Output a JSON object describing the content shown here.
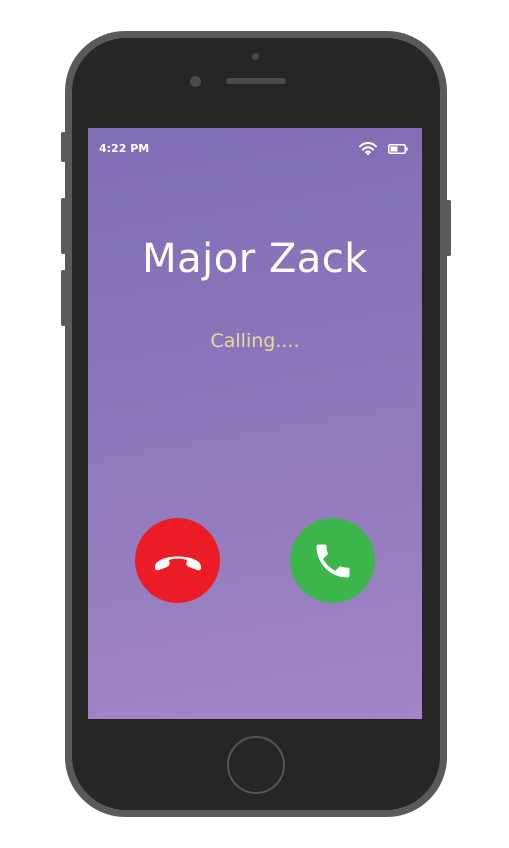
{
  "status_bar": {
    "time": "4:22 PM",
    "wifi_icon": "wifi-icon",
    "battery_icon": "battery-icon"
  },
  "call": {
    "caller_name": "Major Zack",
    "status": "Calling...."
  },
  "actions": {
    "decline_icon": "phone-hangup-icon",
    "accept_icon": "phone-answer-icon"
  },
  "colors": {
    "decline": "#ec1c27",
    "accept": "#3cb54a",
    "status_text": "#e6dc9a",
    "screen_top": "#7f6db5",
    "screen_bottom": "#a385c6"
  }
}
